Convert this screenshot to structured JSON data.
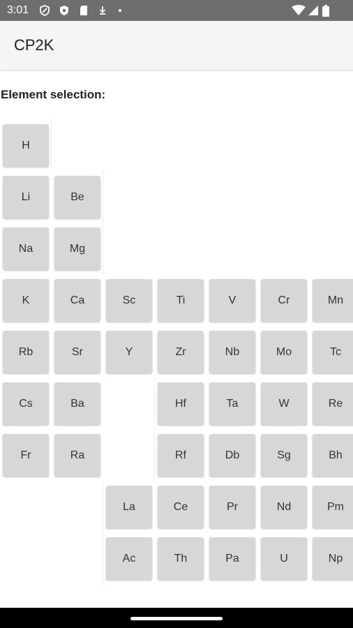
{
  "status_bar": {
    "time": "3:01",
    "icons": [
      "shield-icon",
      "security-icon",
      "sd-card-icon",
      "download-icon",
      "wifi-icon",
      "cellular-signal-icon",
      "battery-icon"
    ],
    "color": "#6e6e6e"
  },
  "app_bar": {
    "title": "CP2K"
  },
  "section": {
    "label": "Element selection:"
  },
  "elements": [
    [
      "H"
    ],
    [
      "Li",
      "Be"
    ],
    [
      "Na",
      "Mg"
    ],
    [
      "K",
      "Ca",
      "Sc",
      "Ti",
      "V",
      "Cr",
      "Mn"
    ],
    [
      "Rb",
      "Sr",
      "Y",
      "Zr",
      "Nb",
      "Mo",
      "Tc"
    ],
    [
      "Cs",
      "Ba",
      "Hf",
      "Ta",
      "W",
      "Re"
    ],
    [
      "Fr",
      "Ra",
      "Rf",
      "Db",
      "Sg",
      "Bh"
    ],
    [
      "La",
      "Ce",
      "Pr",
      "Nd",
      "Pm"
    ],
    [
      "Ac",
      "Th",
      "Pa",
      "U",
      "Np"
    ]
  ],
  "colors": {
    "button_bg": "#d6d7d7",
    "button_text": "#333333",
    "app_bar_bg": "#f5f5f5"
  }
}
